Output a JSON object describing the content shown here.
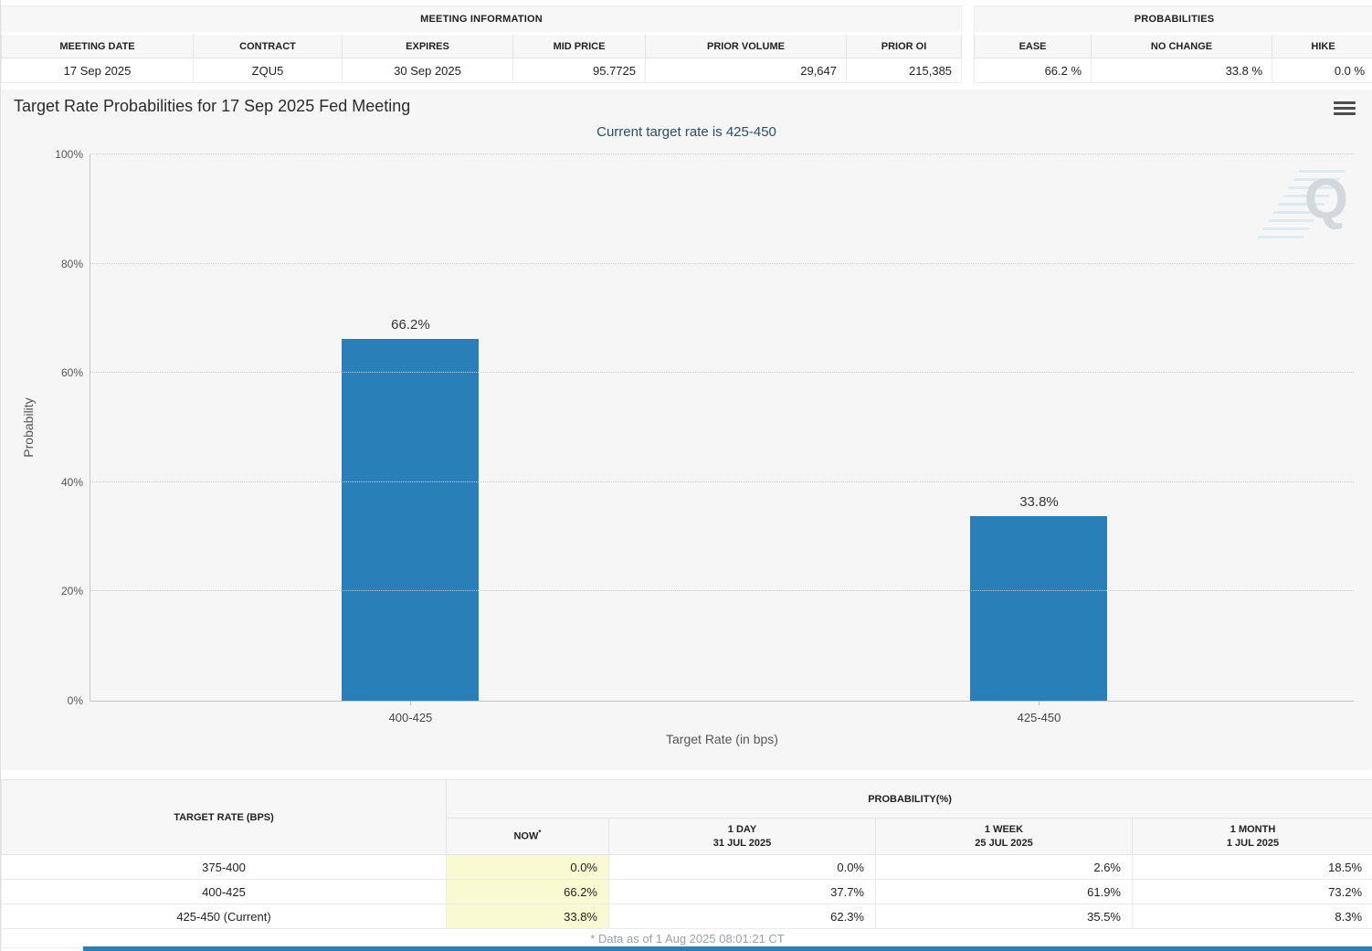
{
  "meeting_info": {
    "title": "MEETING INFORMATION",
    "columns": [
      "MEETING DATE",
      "CONTRACT",
      "EXPIRES",
      "MID PRICE",
      "PRIOR VOLUME",
      "PRIOR OI"
    ],
    "values": [
      "17 Sep 2025",
      "ZQU5",
      "30 Sep 2025",
      "95.7725",
      "29,647",
      "215,385"
    ]
  },
  "probabilities": {
    "title": "PROBABILITIES",
    "columns": [
      "EASE",
      "NO CHANGE",
      "HIKE"
    ],
    "values": [
      "66.2 %",
      "33.8 %",
      "0.0 %"
    ]
  },
  "chart": {
    "title": "Target Rate Probabilities for 17 Sep 2025 Fed Meeting",
    "subtitle": "Current target rate is 425-450",
    "menu_icon": "hamburger-icon",
    "watermark_letter": "Q"
  },
  "chart_data": {
    "type": "bar",
    "title": "Target Rate Probabilities for 17 Sep 2025 Fed Meeting",
    "subtitle": "Current target rate is 425-450",
    "categories": [
      "400-425",
      "425-450"
    ],
    "values": [
      66.2,
      33.8
    ],
    "value_labels": [
      "66.2%",
      "33.8%"
    ],
    "xlabel": "Target Rate (in bps)",
    "ylabel": "Probability",
    "ylim": [
      0,
      100
    ],
    "yticks": [
      "0%",
      "20%",
      "40%",
      "60%",
      "80%",
      "100%"
    ],
    "grid": "horizontal-dotted",
    "legend": "none",
    "bar_color": "#2980b9"
  },
  "history": {
    "corner_header": "TARGET RATE (BPS)",
    "group_header": "PROBABILITY(%)",
    "now": {
      "label": "NOW",
      "sup": "*"
    },
    "sub": [
      {
        "l1": "1 DAY",
        "l2": "31 JUL 2025"
      },
      {
        "l1": "1 WEEK",
        "l2": "25 JUL 2025"
      },
      {
        "l1": "1 MONTH",
        "l2": "1 JUL 2025"
      }
    ],
    "rows": [
      {
        "rate": "375-400",
        "now": "0.0%",
        "day": "0.0%",
        "week": "2.6%",
        "month": "18.5%"
      },
      {
        "rate": "400-425",
        "now": "66.2%",
        "day": "37.7%",
        "week": "61.9%",
        "month": "73.2%"
      },
      {
        "rate": "425-450 (Current)",
        "now": "33.8%",
        "day": "62.3%",
        "week": "35.5%",
        "month": "8.3%"
      }
    ],
    "footnote": "* Data as of 1 Aug 2025 08:01:21 CT"
  },
  "colors": {
    "bar": "#2980b9",
    "subtitle_text": "#2a4d69",
    "now_highlight": "#fafad2",
    "bottom_accent": "#2980b9"
  }
}
